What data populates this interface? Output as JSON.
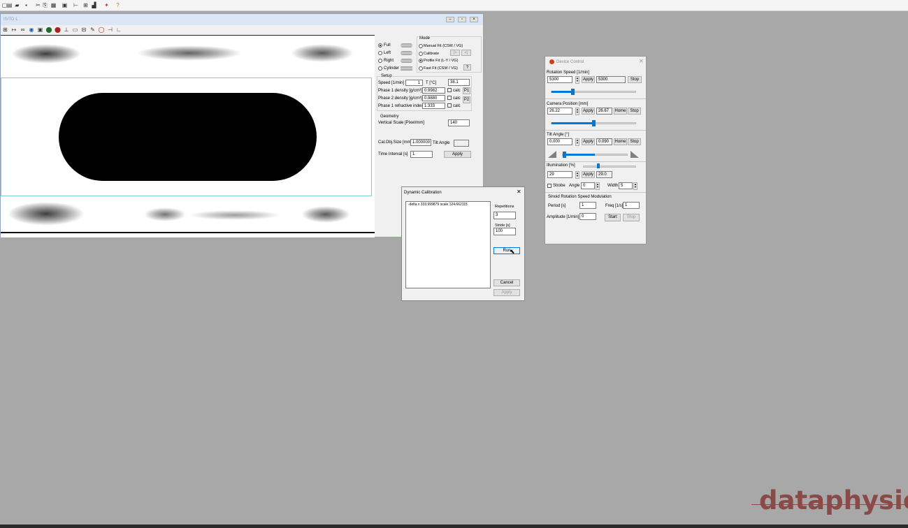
{
  "app": {
    "toolbar_icons": [
      "new-icon",
      "table-icon",
      "open-icon",
      "save-icon",
      "cut-icon",
      "copy-icon",
      "paste-icon",
      "print-icon",
      "fit-icon",
      "measure-icon",
      "chart-icon",
      "pin-icon",
      "help-icon"
    ],
    "child_window": {
      "title": "IS/TD 1",
      "tools": [
        "grid-icon",
        "baseline-icon",
        "zoom-icon",
        "camera-icon",
        "snapshot-icon",
        "color-icon",
        "color2-icon",
        "level-icon",
        "image-icon",
        "export-icon",
        "pen-icon",
        "record-icon",
        "flip-icon",
        "angle-icon"
      ],
      "mode_panel": {
        "shape_options": [
          "Full",
          "Left",
          "Right",
          "Cylinder"
        ],
        "shape_selected": "Full",
        "mode_title": "Mode",
        "mode_options": [
          "Manual Fit  (CSW / VG)",
          "Calibrate",
          "Profile Fit (L-Y / VG)",
          "Fast Fit (CSW / VG)"
        ],
        "mode_selected": "Profile Fit (L-Y / VG)",
        "calib_arrows": [
          "|>",
          "<|"
        ],
        "help_button": "?",
        "setup_title": "Setup",
        "speed_label": "Speed [1/min]",
        "speed_value": "1",
        "temp_label": "T [°C]",
        "temp_value": "38.1",
        "phase1_density_label": "Phase 1 density [g/cm³]",
        "phase1_density_value": "0.9982",
        "phase2_density_label": "Phase 2 density [g/cm³]",
        "phase2_density_value": "0.9880",
        "phase1_refr_label": "Phase 1 refractive index",
        "phase1_refr_value": "1.333",
        "calc_label": "calc",
        "p1_button": "P1",
        "p2_button": "P2",
        "geometry_title": "Geometry",
        "vscale_label": "Vertical Scale [Pixel/mm]",
        "vscale_value": "140",
        "calobj_label": "Cal.Obj.Size [mm]",
        "calobj_value": "1.000000",
        "tilt_label": "Tilt Angle",
        "tilt_value": "",
        "interval_label": "Time Interval [s]",
        "interval_value": "1",
        "apply_button": "Apply"
      }
    },
    "dynamic_calibration": {
      "title": "Dynamic Calibration",
      "log_text": "-delta x 333.999879 scale 124.662115",
      "repetitions_label": "Repetitions",
      "repetitions_value": "3",
      "stride_label": "Stride [s]",
      "stride_value": "100",
      "run_button": "Run",
      "cancel_button": "Cancel",
      "apply_button": "Apply"
    },
    "device_control": {
      "title": "Device Control",
      "rotation": {
        "label": "Rotation Speed [1/min]",
        "input": "5300",
        "apply": "Apply",
        "readout": "5300",
        "stop": "Stop",
        "level": 0.25
      },
      "camera": {
        "label": "Camera Position [mm]",
        "input": "26.22",
        "apply": "Apply",
        "readout": "26.67",
        "home": "Home",
        "stop": "Stop",
        "level": 0.5
      },
      "tilt": {
        "label": "Tilt Angle [°]",
        "input": "0.000",
        "apply": "Apply",
        "readout": "0.090",
        "home": "Home",
        "stop": "Stop",
        "level": 0.5
      },
      "illumination": {
        "label": "Illumination [%]",
        "input": "29",
        "apply": "Apply",
        "readout": "29.0",
        "strobe_label": "Strobe",
        "angle_label": "Angle",
        "angle_value": "0",
        "width_label": "Width",
        "width_value": "5",
        "level": 0.29
      },
      "sinoid": {
        "label": "Sinoid Rotation Speed Modulation",
        "period_label": "Period [s]",
        "period_value": "1",
        "freq_label": "Freq [1/s]",
        "freq_value": "1",
        "amplitude_label": "Amplitude [1/min]",
        "amplitude_value": "0",
        "start": "Start",
        "stop": "Stop"
      }
    },
    "brand": "dataphysics"
  }
}
